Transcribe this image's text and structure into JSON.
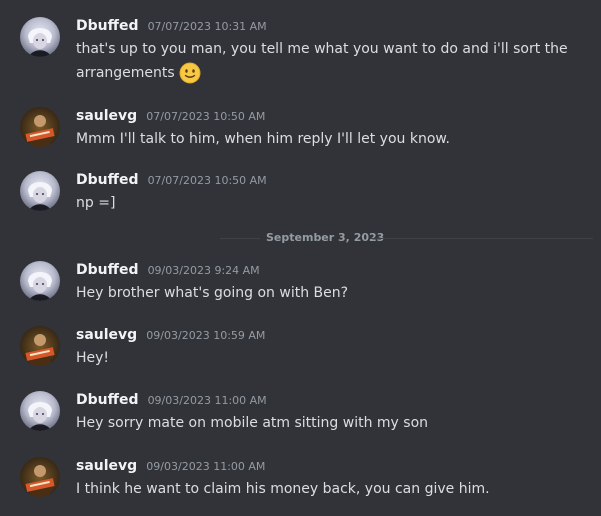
{
  "messages": [
    {
      "username": "Dbuffed",
      "timestamp": "07/07/2023 10:31 AM",
      "text": "that's up to you man, you tell me what you want to do and i'll sort the arrangements",
      "emoji": "slightly-smiling-face",
      "avatar": "dbuffed-avatar"
    },
    {
      "username": "saulevg",
      "timestamp": "07/07/2023 10:50 AM",
      "text": "Mmm I'll talk to him, when him reply I'll let you know.",
      "avatar": "saulevg-avatar"
    },
    {
      "username": "Dbuffed",
      "timestamp": "07/07/2023 10:50 AM",
      "text": "np =]",
      "avatar": "dbuffed-avatar"
    },
    {
      "username": "Dbuffed",
      "timestamp": "09/03/2023 9:24 AM",
      "text": "Hey brother what's going on with Ben?",
      "avatar": "dbuffed-avatar"
    },
    {
      "username": "saulevg",
      "timestamp": "09/03/2023 10:59 AM",
      "text": "Hey!",
      "avatar": "saulevg-avatar"
    },
    {
      "username": "Dbuffed",
      "timestamp": "09/03/2023 11:00 AM",
      "text": "Hey sorry mate on mobile atm sitting with my son",
      "avatar": "dbuffed-avatar"
    },
    {
      "username": "saulevg",
      "timestamp": "09/03/2023 11:00 AM",
      "text": "I think he want to claim his money back, you can give him.",
      "avatar": "saulevg-avatar"
    }
  ],
  "date_divider": {
    "label": "September 3, 2023"
  },
  "colors": {
    "background": "#313338",
    "username": "#f2f3f5",
    "timestamp": "#949ba4",
    "message_text": "#dbdee1",
    "divider_line": "#3f4147"
  }
}
